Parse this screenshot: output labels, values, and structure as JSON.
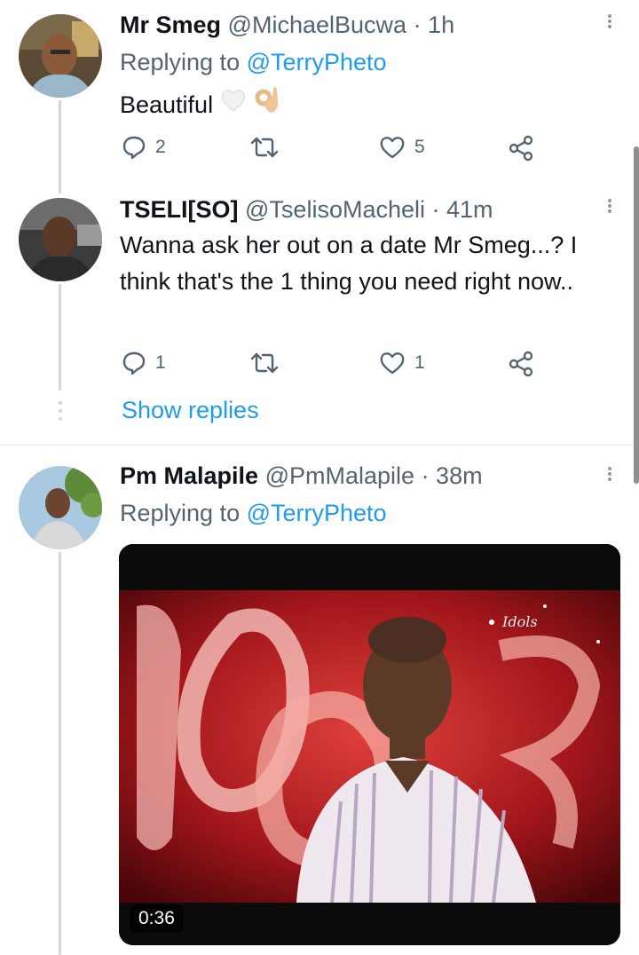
{
  "tweets": [
    {
      "name": "Mr Smeg",
      "handle": "@MichaelBucwa",
      "time": "· 1h",
      "replying_prefix": "Replying to",
      "replying_to": "@TerryPheto",
      "text": "Beautiful",
      "emojis": [
        "white-heart",
        "ok-hand-light-skin"
      ],
      "reply_count": "2",
      "retweet_count": "",
      "like_count": "5"
    },
    {
      "name": "TSELI[SO]",
      "handle": "@TselisoMacheli",
      "time": "· 41m",
      "text": "Wanna ask her out on a date Mr Smeg...? I think that's the 1 thing you need right now..",
      "reply_count": "1",
      "retweet_count": "",
      "like_count": "1",
      "show_replies": "Show replies"
    },
    {
      "name": "Pm Malapile",
      "handle": "@PmMalapile",
      "time": "· 38m",
      "replying_prefix": "Replying to",
      "replying_to": "@TerryPheto",
      "video_duration": "0:36",
      "video_logo": "Idols"
    }
  ],
  "colors": {
    "accent": "#1d9bf0",
    "secondary_text": "#536471",
    "thread_line": "#cfd9de"
  },
  "icons": [
    "more-icon",
    "reply-icon",
    "retweet-icon",
    "like-icon",
    "share-icon"
  ]
}
